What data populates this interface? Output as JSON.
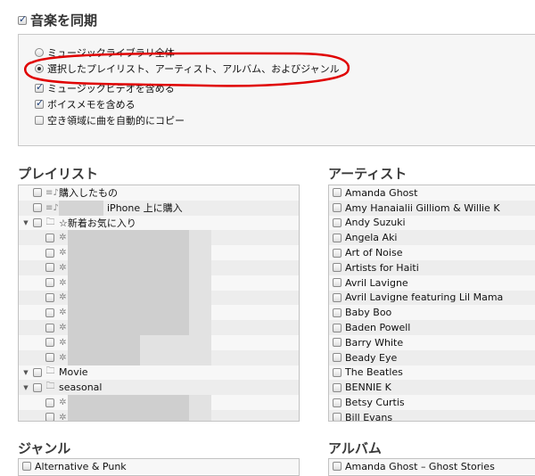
{
  "sync": {
    "label": "音楽を同期",
    "checked": true
  },
  "options": {
    "radios": [
      {
        "label": "ミュージックライブラリ全体",
        "selected": false
      },
      {
        "label": "選択したプレイリスト、アーティスト、アルバム、およびジャンル",
        "selected": true
      }
    ],
    "checks": [
      {
        "label": "ミュージックビデオを含める",
        "checked": true
      },
      {
        "label": "ボイスメモを含める",
        "checked": true
      },
      {
        "label": "空き領域に曲を自動的にコピー",
        "checked": false
      }
    ]
  },
  "annotation_color": "#e00000",
  "playlists": {
    "title": "プレイリスト",
    "items": [
      {
        "label": "購入したもの",
        "icon": "playlist-icon",
        "level": 0
      },
      {
        "label": "iPhone 上に購入",
        "icon": "playlist-icon",
        "level": 0,
        "redacted": true
      },
      {
        "label": "☆新着お気に入り",
        "icon": "folder-icon",
        "level": 0,
        "expanded": true
      },
      {
        "label": "",
        "icon": "smart-playlist-gear-icon",
        "level": 1
      },
      {
        "label": "",
        "icon": "smart-playlist-gear-icon",
        "level": 1
      },
      {
        "label": "",
        "icon": "smart-playlist-gear-icon",
        "level": 1
      },
      {
        "label": "",
        "icon": "smart-playlist-gear-icon",
        "level": 1
      },
      {
        "label": "",
        "icon": "smart-playlist-gear-icon",
        "level": 1
      },
      {
        "label": "",
        "icon": "smart-playlist-gear-icon",
        "level": 1
      },
      {
        "label": "",
        "icon": "smart-playlist-gear-icon",
        "level": 1
      },
      {
        "label": "",
        "icon": "smart-playlist-gear-icon",
        "level": 1
      },
      {
        "label": "",
        "icon": "smart-playlist-gear-icon",
        "level": 1
      },
      {
        "label": "Movie",
        "icon": "folder-icon",
        "level": 0,
        "expanded": true
      },
      {
        "label": "seasonal",
        "icon": "folder-icon",
        "level": 0,
        "expanded": true
      },
      {
        "label": "",
        "icon": "smart-playlist-gear-icon",
        "level": 1
      },
      {
        "label": "",
        "icon": "smart-playlist-gear-icon",
        "level": 1
      }
    ]
  },
  "artists": {
    "title": "アーティスト",
    "items": [
      "Amanda Ghost",
      "Amy Hanaialii Gilliom & Willie K",
      "Andy Suzuki",
      "Angela Aki",
      "Art of Noise",
      "Artists for Haiti",
      "Avril Lavigne",
      "Avril Lavigne featuring Lil Mama",
      "Baby Boo",
      "Baden Powell",
      "Barry White",
      "Beady Eye",
      "The Beatles",
      "BENNIE K",
      "Betsy Curtis",
      "Bill Evans"
    ]
  },
  "genres": {
    "title": "ジャンル",
    "items": [
      "Alternative & Punk"
    ]
  },
  "albums": {
    "title": "アルバム",
    "items": [
      "Amanda Ghost – Ghost Stories"
    ]
  }
}
